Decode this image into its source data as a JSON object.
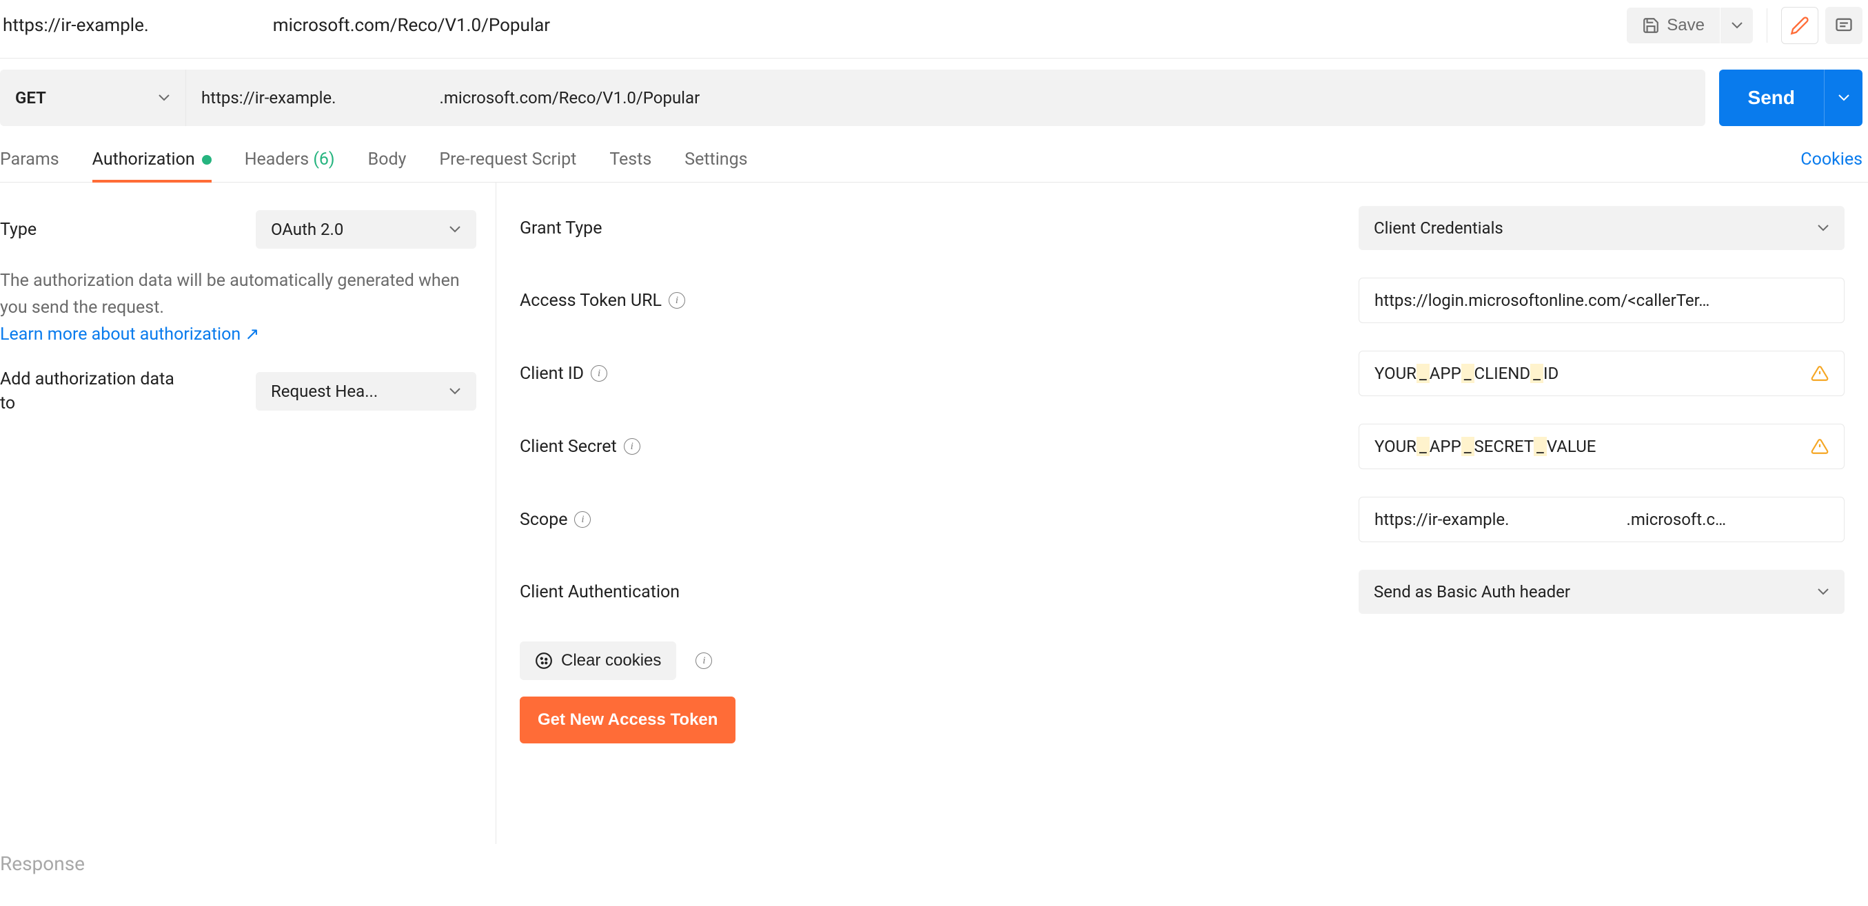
{
  "topbar": {
    "url_part1": "https://ir-example.",
    "url_part2": "microsoft.com/Reco/V1.0/Popular",
    "save_label": "Save"
  },
  "request": {
    "method": "GET",
    "url_part1": "https://ir-example.",
    "url_part2": ".microsoft.com/Reco/V1.0/Popular",
    "send_label": "Send"
  },
  "tabs": {
    "params": "Params",
    "authorization": "Authorization",
    "headers": "Headers",
    "headers_count": "(6)",
    "body": "Body",
    "prerequest": "Pre-request Script",
    "tests": "Tests",
    "settings": "Settings",
    "cookies": "Cookies"
  },
  "auth_sidebar": {
    "type_label": "Type",
    "type_value": "OAuth 2.0",
    "help_text1": "The authorization data will be automatically generated when you send the request.",
    "learn_more": "Learn more about authorization",
    "arrow": "↗",
    "add_to_label": "Add authorization data to",
    "add_to_value": "Request Hea..."
  },
  "auth_form": {
    "grant_type_label": "Grant Type",
    "grant_type_value": "Client Credentials",
    "access_token_url_label": "Access Token URL",
    "access_token_url_value": "https://login.microsoftonline.com/<callerTer…",
    "client_id_label": "Client ID",
    "client_id_value_p1": "YOUR",
    "client_id_value_p2": "APP",
    "client_id_value_p3": "CLIEND",
    "client_id_value_p4": "ID",
    "client_secret_label": "Client Secret",
    "client_secret_value_p1": "YOUR",
    "client_secret_value_p2": "APP",
    "client_secret_value_p3": "SECRET",
    "client_secret_value_p4": "VALUE",
    "scope_label": "Scope",
    "scope_value_p1": "https://ir-example.",
    "scope_value_p2": ".microsoft.c…",
    "client_auth_label": "Client Authentication",
    "client_auth_value": "Send as Basic Auth header",
    "clear_cookies": "Clear cookies",
    "get_token": "Get New Access Token"
  },
  "response_label": "Response"
}
